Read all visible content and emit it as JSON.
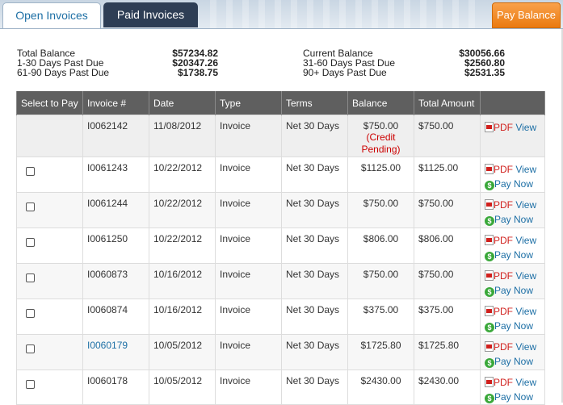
{
  "tabs": [
    {
      "label": "Open Invoices",
      "active": true
    },
    {
      "label": "Paid Invoices",
      "active": false
    }
  ],
  "pay_balance_label": "Pay Balance",
  "summary": {
    "left": [
      {
        "label": "Total Balance",
        "value": "$57234.82"
      },
      {
        "label": "1-30 Days Past Due",
        "value": "$20347.26"
      },
      {
        "label": "61-90 Days Past Due",
        "value": "$1738.75"
      }
    ],
    "right": [
      {
        "label": "Current Balance",
        "value": "$30056.66"
      },
      {
        "label": "31-60 Days Past Due",
        "value": "$2560.80"
      },
      {
        "label": "90+ Days Past Due",
        "value": "$2531.35"
      }
    ]
  },
  "table": {
    "headers": [
      "Select to Pay",
      "Invoice #",
      "Date",
      "Type",
      "Terms",
      "Balance",
      "Total Amount",
      ""
    ],
    "pdf_label": "PDF",
    "view_label": "View",
    "pay_now_label": "Pay Now",
    "rows": [
      {
        "invoice": "I0062142",
        "date": "11/08/2012",
        "type": "Invoice",
        "terms": "Net 30 Days",
        "balance": "$750.00",
        "note": "(Credit Pending)",
        "total": "$750.00",
        "selectable": false,
        "pay_now": false,
        "invoice_link": false
      },
      {
        "invoice": "I0061243",
        "date": "10/22/2012",
        "type": "Invoice",
        "terms": "Net 30 Days",
        "balance": "$1125.00",
        "note": "",
        "total": "$1125.00",
        "selectable": true,
        "pay_now": true,
        "invoice_link": false
      },
      {
        "invoice": "I0061244",
        "date": "10/22/2012",
        "type": "Invoice",
        "terms": "Net 30 Days",
        "balance": "$750.00",
        "note": "",
        "total": "$750.00",
        "selectable": true,
        "pay_now": true,
        "invoice_link": false
      },
      {
        "invoice": "I0061250",
        "date": "10/22/2012",
        "type": "Invoice",
        "terms": "Net 30 Days",
        "balance": "$806.00",
        "note": "",
        "total": "$806.00",
        "selectable": true,
        "pay_now": true,
        "invoice_link": false
      },
      {
        "invoice": "I0060873",
        "date": "10/16/2012",
        "type": "Invoice",
        "terms": "Net 30 Days",
        "balance": "$750.00",
        "note": "",
        "total": "$750.00",
        "selectable": true,
        "pay_now": true,
        "invoice_link": false
      },
      {
        "invoice": "I0060874",
        "date": "10/16/2012",
        "type": "Invoice",
        "terms": "Net 30 Days",
        "balance": "$375.00",
        "note": "",
        "total": "$375.00",
        "selectable": true,
        "pay_now": true,
        "invoice_link": false
      },
      {
        "invoice": "I0060179",
        "date": "10/05/2012",
        "type": "Invoice",
        "terms": "Net 30 Days",
        "balance": "$1725.80",
        "note": "",
        "total": "$1725.80",
        "selectable": true,
        "pay_now": true,
        "invoice_link": true
      },
      {
        "invoice": "I0060178",
        "date": "10/05/2012",
        "type": "Invoice",
        "terms": "Net 30 Days",
        "balance": "$2430.00",
        "note": "",
        "total": "$2430.00",
        "selectable": true,
        "pay_now": true,
        "invoice_link": false
      }
    ]
  },
  "colors": {
    "tab_active_text": "#1d6fa5",
    "tab_inactive_bg": "#2e3e55",
    "pay_balance_bg": "#ea7a10",
    "header_bg": "#5f5f5f",
    "link": "#1d6fa5",
    "pending": "#cc0000"
  }
}
